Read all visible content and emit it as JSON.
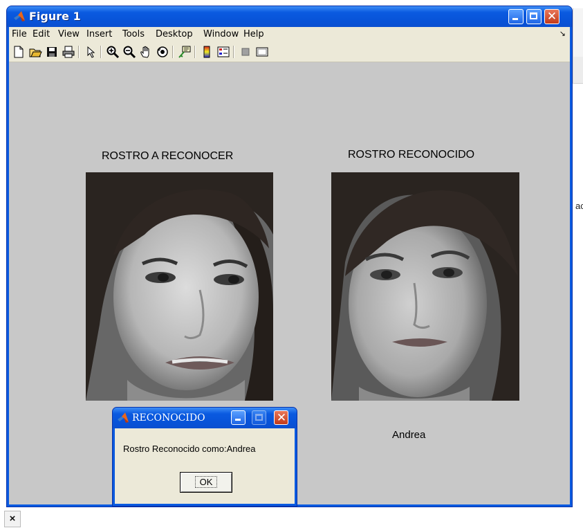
{
  "window": {
    "title": "Figure 1",
    "menu": [
      "File",
      "Edit",
      "View",
      "Insert",
      "Tools",
      "Desktop",
      "Window",
      "Help"
    ],
    "menu_overflow_arrow": "↘",
    "toolbar_icons": [
      "new-figure-icon",
      "open-file-icon",
      "save-icon",
      "print-icon",
      "edit-plot-arrow-icon",
      "zoom-in-icon",
      "zoom-out-icon",
      "pan-hand-icon",
      "rotate-3d-icon",
      "data-cursor-icon",
      "insert-colorbar-icon",
      "insert-legend-icon",
      "hide-plot-tools-icon",
      "show-plot-tools-icon"
    ]
  },
  "figure": {
    "left_title": "ROSTRO A RECONOCER",
    "right_title": "ROSTRO RECONOCIDO",
    "recognized_name": "Andrea"
  },
  "dialog": {
    "title": "RECONOCIDO",
    "message": "Rostro Reconocido como:Andrea",
    "ok_label": "OK"
  },
  "background": {
    "fragment_text": "ac",
    "close_glyph": "×"
  },
  "colors": {
    "titlebar_blue": "#0a5ae0",
    "figure_background": "#c8c8c8",
    "menu_background": "#ece9d8",
    "close_button_red": "#c23a1a"
  }
}
